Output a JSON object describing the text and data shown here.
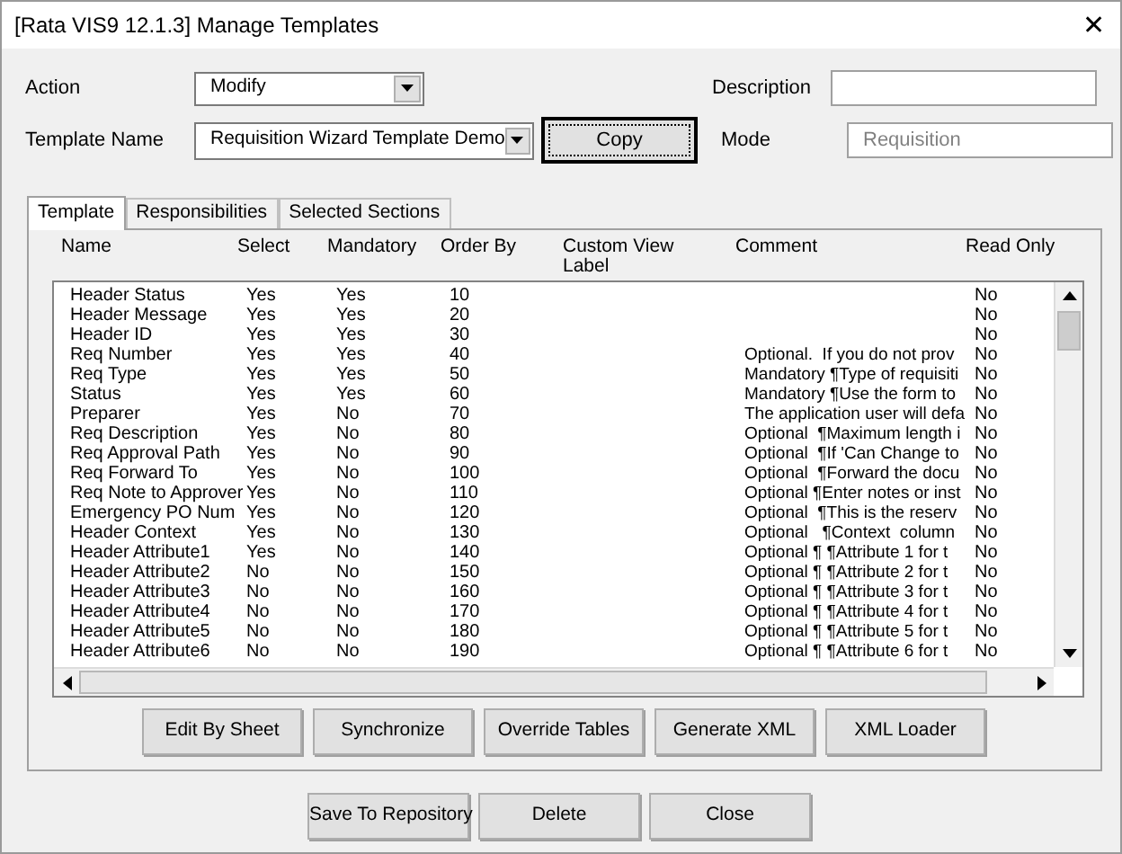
{
  "window": {
    "title": "[Rata VIS9 12.1.3] Manage Templates",
    "close": "✕"
  },
  "form": {
    "action": {
      "label": "Action",
      "value": "Modify"
    },
    "template_name": {
      "label": "Template Name",
      "value": "Requisition Wizard Template Demo"
    },
    "copy_button": {
      "label": "Copy",
      "focused": true
    },
    "description": {
      "label": "Description"
    },
    "mode": {
      "label": "Mode",
      "placeholder": "Requisition"
    }
  },
  "tabs": [
    {
      "label": "Template",
      "selected": true
    },
    {
      "label": "Responsibilities",
      "selected": false
    },
    {
      "label": "Selected Sections",
      "selected": false
    }
  ],
  "table": {
    "columns": [
      "Name",
      "Select",
      "Mandatory",
      "Order By",
      "Custom View Label",
      "Comment",
      "Read Only"
    ],
    "rows": [
      {
        "name": "Header Status",
        "select": "Yes",
        "mandatory": "Yes",
        "order_by": "10",
        "read_only": "No"
      },
      {
        "name": "Header Message",
        "select": "Yes",
        "mandatory": "Yes",
        "order_by": "20",
        "read_only": "No"
      },
      {
        "name": "Header ID",
        "select": "Yes",
        "mandatory": "Yes",
        "order_by": "30",
        "read_only": "No"
      },
      {
        "name": "Req Number",
        "select": "Yes",
        "mandatory": "Yes",
        "order_by": "40",
        "comment": "Optional.  If you do not prov",
        "read_only": "No"
      },
      {
        "name": "Req Type",
        "select": "Yes",
        "mandatory": "Yes",
        "order_by": "50",
        "comment": "Mandatory ¶Type of requisiti",
        "read_only": "No"
      },
      {
        "name": "Status",
        "select": "Yes",
        "mandatory": "Yes",
        "order_by": "60",
        "comment": "Mandatory ¶Use the form to",
        "read_only": "No"
      },
      {
        "name": "Preparer",
        "select": "Yes",
        "mandatory": "No",
        "order_by": "70",
        "comment": "The application user will defa",
        "read_only": "No"
      },
      {
        "name": "Req Description",
        "select": "Yes",
        "mandatory": "No",
        "order_by": "80",
        "comment": "Optional  ¶Maximum length i",
        "read_only": "No"
      },
      {
        "name": "Req Approval Path",
        "select": "Yes",
        "mandatory": "No",
        "order_by": "90",
        "comment": "Optional  ¶If 'Can Change to",
        "read_only": "No"
      },
      {
        "name": "Req Forward To",
        "select": "Yes",
        "mandatory": "No",
        "order_by": "100",
        "comment": "Optional  ¶Forward the docu",
        "read_only": "No"
      },
      {
        "name": "Req Note to Approver",
        "select": "Yes",
        "mandatory": "No",
        "order_by": "110",
        "comment": "Optional ¶Enter notes or inst",
        "read_only": "No"
      },
      {
        "name": "Emergency PO Num",
        "select": "Yes",
        "mandatory": "No",
        "order_by": "120",
        "comment": "Optional  ¶This is the reserv",
        "read_only": "No"
      },
      {
        "name": "Header Context",
        "select": "Yes",
        "mandatory": "No",
        "order_by": "130",
        "comment": "Optional   ¶Context  column",
        "read_only": "No"
      },
      {
        "name": "Header Attribute1",
        "select": "Yes",
        "mandatory": "No",
        "order_by": "140",
        "comment": "Optional ¶ ¶Attribute 1 for t",
        "read_only": "No"
      },
      {
        "name": "Header Attribute2",
        "select": "No",
        "mandatory": "No",
        "order_by": "150",
        "comment": "Optional ¶ ¶Attribute 2 for t",
        "read_only": "No"
      },
      {
        "name": "Header Attribute3",
        "select": "No",
        "mandatory": "No",
        "order_by": "160",
        "comment": "Optional ¶ ¶Attribute 3 for t",
        "read_only": "No"
      },
      {
        "name": "Header Attribute4",
        "select": "No",
        "mandatory": "No",
        "order_by": "170",
        "comment": "Optional ¶ ¶Attribute 4 for t",
        "read_only": "No"
      },
      {
        "name": "Header Attribute5",
        "select": "No",
        "mandatory": "No",
        "order_by": "180",
        "comment": "Optional ¶ ¶Attribute 5 for t",
        "read_only": "No"
      },
      {
        "name": "Header Attribute6",
        "select": "No",
        "mandatory": "No",
        "order_by": "190",
        "comment": "Optional ¶ ¶Attribute 6 for t",
        "read_only": "No"
      }
    ]
  },
  "panel_buttons": [
    "Edit By Sheet",
    "Synchronize",
    "Override Tables",
    "Generate XML",
    "XML Loader"
  ],
  "buttons": [
    "Save To Repository",
    "Delete",
    "Close"
  ]
}
